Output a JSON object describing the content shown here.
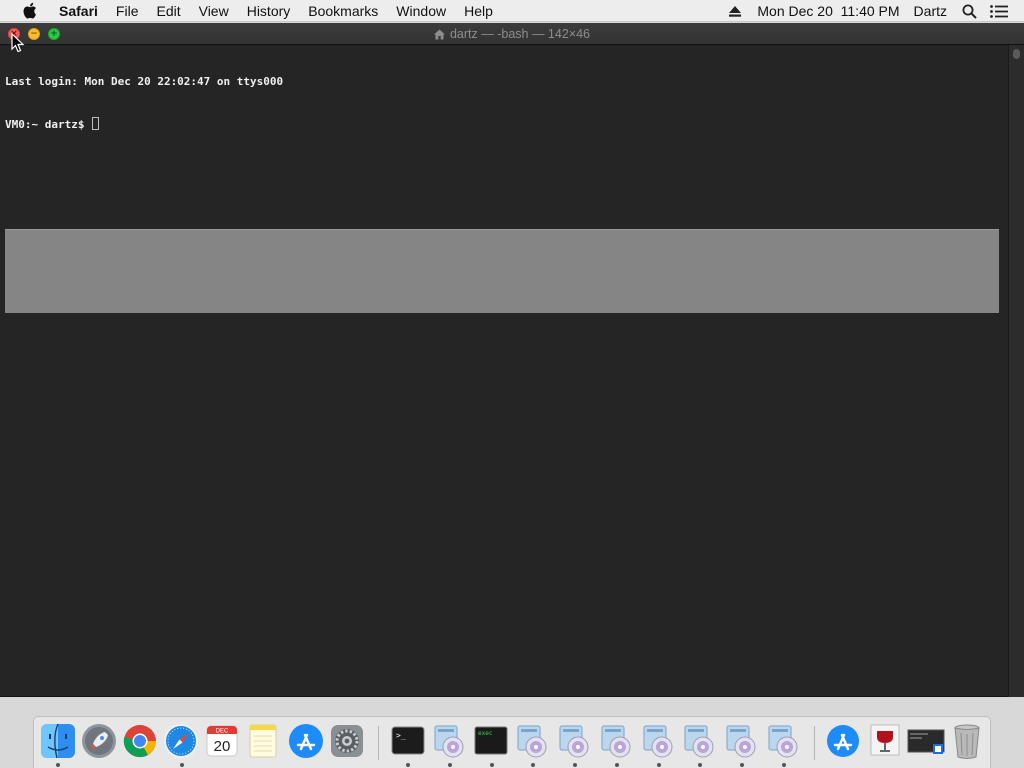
{
  "menubar": {
    "apple_icon": "apple-logo-icon",
    "app_name": "Safari",
    "items": [
      "File",
      "Edit",
      "View",
      "History",
      "Bookmarks",
      "Window",
      "Help"
    ],
    "right": {
      "eject_icon": "eject-icon",
      "datetime": "Mon Dec 20  11:40 PM",
      "user": "Dartz",
      "spotlight_icon": "spotlight-search-icon",
      "notification_icon": "notification-center-icon"
    }
  },
  "window": {
    "title": "dartz — -bash — 142×46",
    "home_icon": "home-folder-icon",
    "buttons": {
      "close": "×",
      "minimize": "−",
      "zoom": "+"
    },
    "terminal": {
      "lines": [
        "Last login: Mon Dec 20 22:02:47 on ttys000",
        "VM0:~ dartz$ "
      ]
    }
  },
  "dock": {
    "apps": [
      {
        "name": "Finder",
        "icon": "finder-icon"
      },
      {
        "name": "Launchpad",
        "icon": "launchpad-rocket-icon"
      },
      {
        "name": "Google Chrome",
        "icon": "chrome-icon"
      },
      {
        "name": "Safari",
        "icon": "safari-compass-icon"
      },
      {
        "name": "Calendar",
        "icon": "calendar-icon",
        "month": "DEC",
        "day": "20"
      },
      {
        "name": "Notes",
        "icon": "notes-icon"
      },
      {
        "name": "App Store",
        "icon": "app-store-icon"
      },
      {
        "name": "System Preferences",
        "icon": "gear-icon"
      },
      {
        "name": "Terminal",
        "icon": "terminal-icon",
        "glyph": ">_"
      },
      {
        "name": "Installer",
        "icon": "installer-disc-icon"
      },
      {
        "name": "exec",
        "icon": "exec-terminal-icon",
        "glyph": "exec"
      },
      {
        "name": "Installer",
        "icon": "installer-disc-icon"
      },
      {
        "name": "Installer",
        "icon": "installer-disc-icon"
      },
      {
        "name": "Installer",
        "icon": "installer-disc-icon"
      },
      {
        "name": "Installer",
        "icon": "installer-disc-icon"
      },
      {
        "name": "Installer",
        "icon": "installer-disc-icon"
      },
      {
        "name": "Installer",
        "icon": "installer-disc-icon"
      },
      {
        "name": "Installer",
        "icon": "installer-disc-icon"
      },
      {
        "name": "Applications",
        "icon": "applications-folder-icon"
      },
      {
        "name": "Documents",
        "icon": "wine-document-icon"
      },
      {
        "name": "Downloads",
        "icon": "screenshot-folder-icon"
      },
      {
        "name": "Trash",
        "icon": "trash-icon"
      }
    ]
  },
  "colors": {
    "terminal_bg": "#252525",
    "terminal_text": "#f0f0f0",
    "overlay_bar": "#858585",
    "close": "#fc5c57",
    "minimize": "#fdbc2e",
    "zoom": "#29c941"
  }
}
